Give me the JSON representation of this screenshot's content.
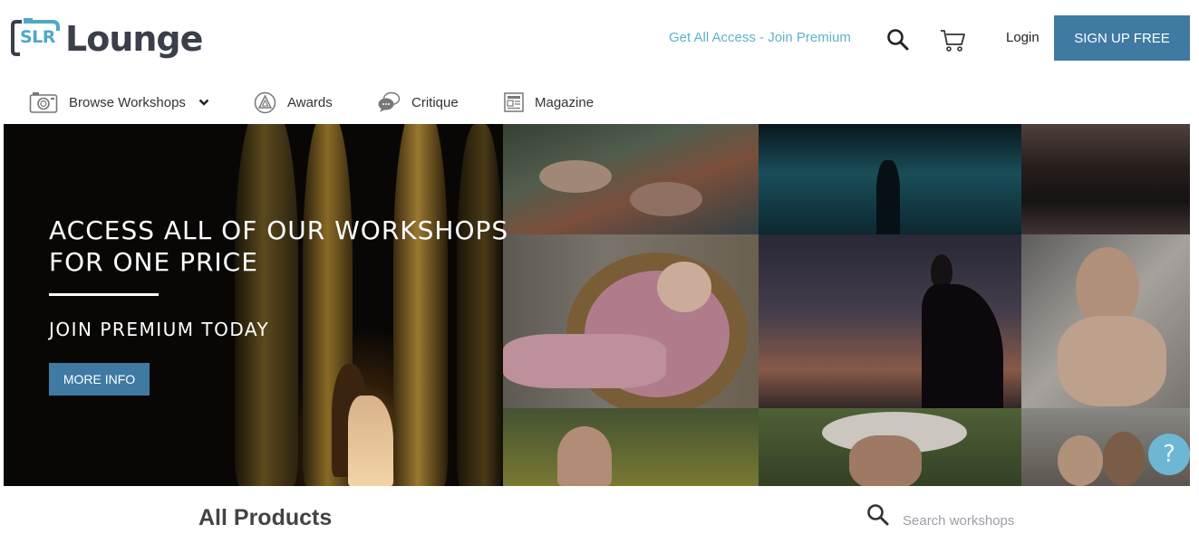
{
  "brand": {
    "logo_mark": "SLR",
    "logo_word": "Lounge"
  },
  "header": {
    "premium_link": "Get All Access - Join Premium",
    "login": "Login",
    "signup": "SIGN UP FREE"
  },
  "nav": {
    "items": [
      {
        "label": "Browse Workshops",
        "icon": "camera-icon"
      },
      {
        "label": "Awards",
        "icon": "award-icon"
      },
      {
        "label": "Critique",
        "icon": "chat-icon"
      },
      {
        "label": "Magazine",
        "icon": "magazine-icon"
      }
    ]
  },
  "hero": {
    "title_line1": "ACCESS ALL OF OUR WORKSHOPS",
    "title_line2": "FOR ONE PRICE",
    "subtitle": "JOIN PREMIUM TODAY",
    "button": "MORE INFO",
    "help": "?"
  },
  "products": {
    "heading": "All Products",
    "search_placeholder": "Search workshops"
  },
  "colors": {
    "accent": "#3f7aa3",
    "link": "#5fb2cb",
    "help": "#6db6d4"
  }
}
